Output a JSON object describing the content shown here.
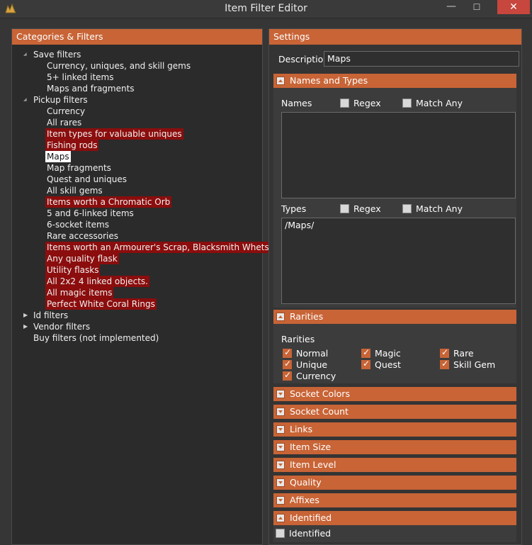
{
  "window": {
    "title": "Item Filter Editor",
    "min_glyph": "—",
    "max_glyph": "☐",
    "close_glyph": "✕"
  },
  "left_panel": {
    "header": "Categories & Filters",
    "tree": [
      {
        "label": "Save filters",
        "level": 0,
        "expander": "expanded"
      },
      {
        "label": "Currency, uniques, and skill gems",
        "level": 1
      },
      {
        "label": "5+ linked items",
        "level": 1
      },
      {
        "label": "Maps and fragments",
        "level": 1
      },
      {
        "label": "Pickup filters",
        "level": 0,
        "expander": "expanded"
      },
      {
        "label": "Currency",
        "level": 1
      },
      {
        "label": "All rares",
        "level": 1
      },
      {
        "label": "Item types for valuable uniques",
        "level": 1,
        "highlight": "red"
      },
      {
        "label": "Fishing rods",
        "level": 1,
        "highlight": "red"
      },
      {
        "label": "Maps",
        "level": 1,
        "highlight": "selected"
      },
      {
        "label": "Map fragments",
        "level": 1
      },
      {
        "label": "Quest and uniques",
        "level": 1
      },
      {
        "label": "All skill gems",
        "level": 1
      },
      {
        "label": "Items worth a Chromatic Orb",
        "level": 1,
        "highlight": "red"
      },
      {
        "label": "5 and 6-linked items",
        "level": 1
      },
      {
        "label": "6-socket items",
        "level": 1
      },
      {
        "label": "Rare accessories",
        "level": 1
      },
      {
        "label": "Items worth an Armourer's Scrap, Blacksmith Whetstone",
        "level": 1,
        "highlight": "red"
      },
      {
        "label": "Any quality flask",
        "level": 1,
        "highlight": "red"
      },
      {
        "label": "Utility flasks",
        "level": 1,
        "highlight": "red"
      },
      {
        "label": "All 2x2 4 linked objects.",
        "level": 1,
        "highlight": "red"
      },
      {
        "label": "All magic items",
        "level": 1,
        "highlight": "red"
      },
      {
        "label": "Perfect White Coral Rings",
        "level": 1,
        "highlight": "red"
      },
      {
        "label": "Id filters",
        "level": 0,
        "expander": "collapsed"
      },
      {
        "label": "Vendor filters",
        "level": 0,
        "expander": "collapsed"
      },
      {
        "label": "Buy filters (not implemented)",
        "level": 0
      }
    ]
  },
  "settings": {
    "header": "Settings",
    "description_label": "Description",
    "description_value": "Maps",
    "names_and_types": {
      "title": "Names and Types",
      "names_label": "Names",
      "regex_label": "Regex",
      "match_any_label": "Match Any",
      "names_value": "",
      "types_label": "Types",
      "types_value": "/Maps/"
    },
    "rarities": {
      "title": "Rarities",
      "label": "Rarities",
      "options": [
        {
          "label": "Normal",
          "checked": true
        },
        {
          "label": "Magic",
          "checked": true
        },
        {
          "label": "Rare",
          "checked": true
        },
        {
          "label": "Unique",
          "checked": true
        },
        {
          "label": "Quest",
          "checked": true
        },
        {
          "label": "Skill Gem",
          "checked": true
        },
        {
          "label": "Currency",
          "checked": true
        }
      ]
    },
    "collapsed_sections": [
      "Socket Colors",
      "Socket Count",
      "Links",
      "Item Size",
      "Item Level",
      "Quality",
      "Affixes"
    ],
    "identified": {
      "title": "Identified",
      "checkbox_label": "Identified",
      "checked": false
    }
  },
  "colors": {
    "accent": "#c86436",
    "highlight_red": "#8b0d0d",
    "close_red": "#c7463d"
  }
}
